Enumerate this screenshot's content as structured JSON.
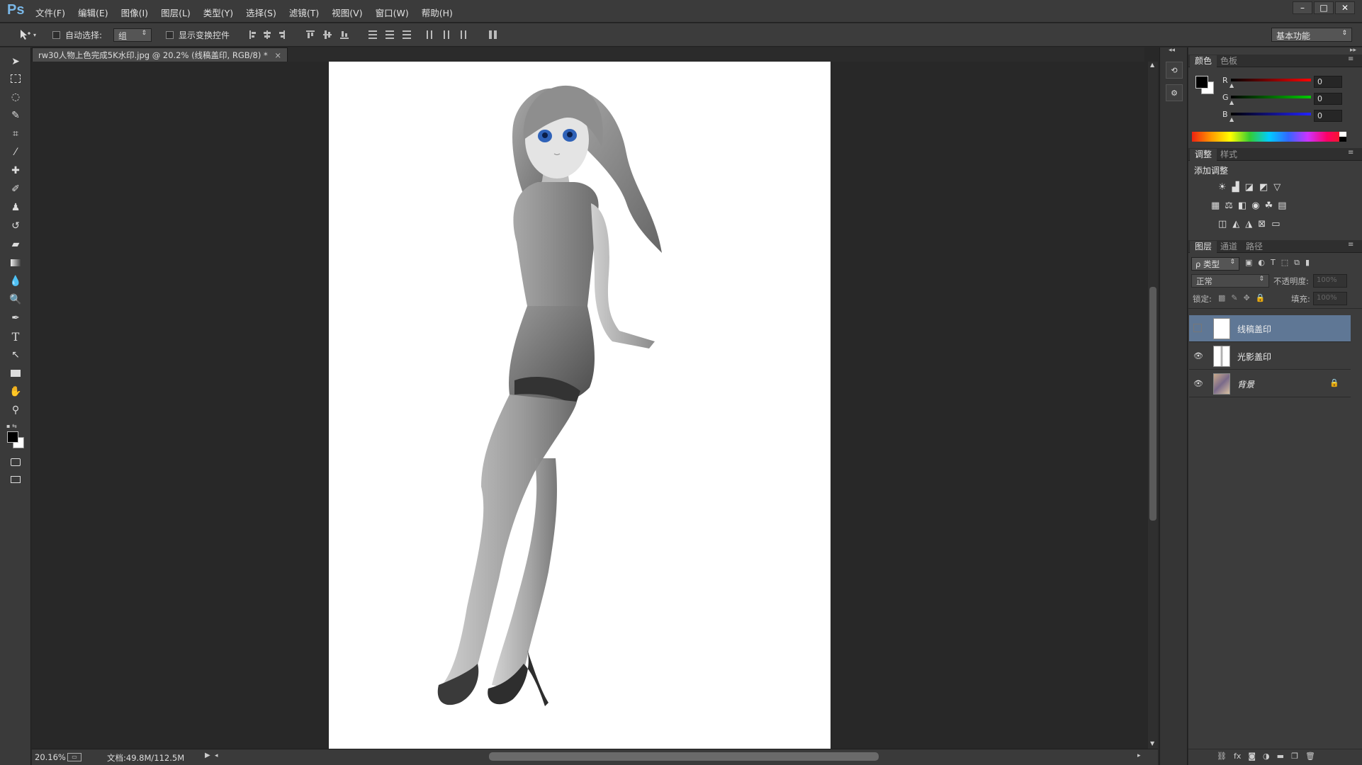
{
  "app": {
    "logo": "Ps"
  },
  "menu": [
    "文件(F)",
    "编辑(E)",
    "图像(I)",
    "图层(L)",
    "类型(Y)",
    "选择(S)",
    "滤镜(T)",
    "视图(V)",
    "窗口(W)",
    "帮助(H)"
  ],
  "window_buttons": [
    "–",
    "□",
    "✕"
  ],
  "options": {
    "auto_select_label": "自动选择:",
    "auto_select_value": "组",
    "show_transform_label": "显示变换控件",
    "workspace": "基本功能"
  },
  "document": {
    "tab_title": "rw30人物上色完成5K水印.jpg @ 20.2% (线稿盖印, RGB/8) *",
    "close": "×"
  },
  "status": {
    "zoom": "20.16%",
    "doc_info": "文档:49.8M/112.5M"
  },
  "color_panel": {
    "tabs": [
      "颜色",
      "色板"
    ],
    "channels": [
      {
        "label": "R",
        "value": "0"
      },
      {
        "label": "G",
        "value": "0"
      },
      {
        "label": "B",
        "value": "0"
      }
    ],
    "foreground": "#000000",
    "background": "#ffffff"
  },
  "adjust_panel": {
    "tabs": [
      "调整",
      "样式"
    ],
    "title": "添加调整"
  },
  "layers_panel": {
    "tabs": [
      "图层",
      "通道",
      "路径"
    ],
    "filter_label": "ρ 类型",
    "blend_mode": "正常",
    "opacity_label": "不透明度:",
    "opacity_value": "100%",
    "lock_label": "锁定:",
    "fill_label": "填充:",
    "fill_value": "100%",
    "layers": [
      {
        "name": "线稿盖印",
        "visible": false,
        "selected": true
      },
      {
        "name": "光影盖印",
        "visible": true,
        "selected": false
      },
      {
        "name": "背景",
        "visible": true,
        "selected": false,
        "locked": true
      }
    ]
  },
  "colors": {
    "accent_selected": "#5f7795",
    "panel": "#3c3c3c",
    "canvas_bg": "#282828"
  }
}
